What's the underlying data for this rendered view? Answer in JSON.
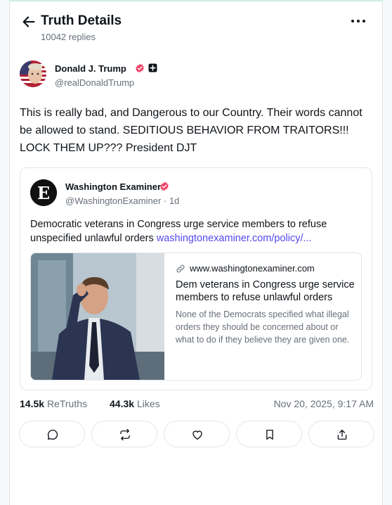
{
  "header": {
    "title": "Truth Details",
    "replies": "10042 replies",
    "back_icon": "arrow-left-icon",
    "more_icon": "more-horizontal-icon"
  },
  "author": {
    "name": "Donald J. Trump",
    "handle": "@realDonaldTrump",
    "verified_icon": "verified-badge-icon",
    "extra_badge_icon": "plus-badge-icon"
  },
  "post": {
    "text": "This is really bad, and Dangerous to our Country. Their words cannot be allowed to stand. SEDITIOUS BEHAVIOR FROM TRAITORS!!! LOCK THEM UP??? President DJT"
  },
  "quote": {
    "name": "Washington Examiner",
    "handle": "@WashingtonExaminer · 1d",
    "text": "Democratic veterans in Congress urge service members to refuse unspecified unlawful orders ",
    "link_text": "washingtonexaminer.com/policy/...",
    "card": {
      "domain": "www.washingtonexaminer.com",
      "title": "Dem veterans in Congress urge service members to refuse unlawful orders",
      "description": "None of the Democrats specified what illegal orders they should be concerned about or what to do if they believe they are given one."
    }
  },
  "stats": {
    "retruths_count": "14.5k",
    "retruths_label": "ReTruths",
    "likes_count": "44.3k",
    "likes_label": "Likes",
    "timestamp": "Nov 20, 2025, 9:17 AM"
  },
  "actions": [
    {
      "name": "reply",
      "icon": "reply-bubble-icon"
    },
    {
      "name": "retruth",
      "icon": "retruth-icon"
    },
    {
      "name": "like",
      "icon": "heart-icon"
    },
    {
      "name": "bookmark",
      "icon": "bookmark-icon"
    },
    {
      "name": "share",
      "icon": "share-icon"
    }
  ],
  "colors": {
    "accent_link": "#5448ee",
    "verified": "#f0476a",
    "muted_text": "#68707a",
    "border": "#e3e5e8"
  }
}
